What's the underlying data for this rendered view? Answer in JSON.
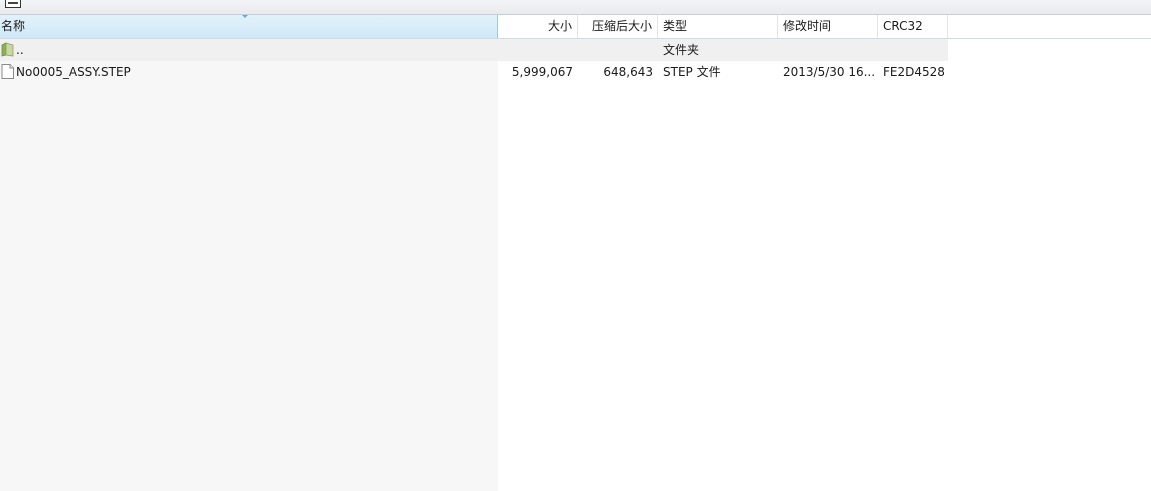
{
  "columns": {
    "name": "名称",
    "size": "大小",
    "packed": "压缩后大小",
    "type": "类型",
    "mtime": "修改时间",
    "crc": "CRC32"
  },
  "rows": [
    {
      "icon": "folder-up-icon",
      "name": "..",
      "size": "",
      "packed": "",
      "type": "文件夹",
      "mtime": "",
      "crc": ""
    },
    {
      "icon": "file-icon",
      "name": "No0005_ASSY.STEP",
      "size": "5,999,067",
      "packed": "648,643",
      "type": "STEP 文件",
      "mtime": "2013/5/30 16...",
      "crc": "FE2D4528"
    }
  ],
  "colors": {
    "header_selected": "#cfe8f8",
    "name_column_bg": "#f7f7f7"
  }
}
